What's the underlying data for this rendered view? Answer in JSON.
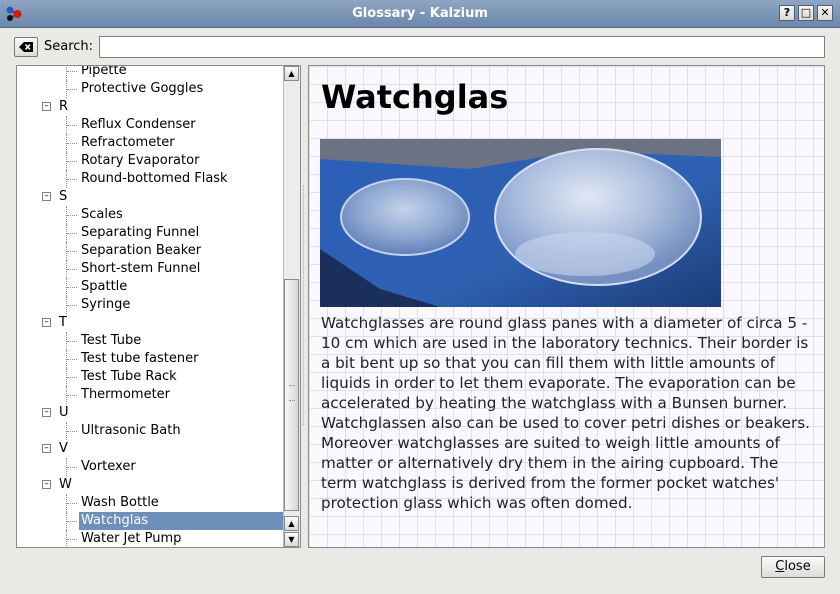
{
  "window": {
    "title": "Glossary - Kalzium"
  },
  "titlebar_buttons": {
    "help": "?",
    "maximize": "□",
    "close": "✕"
  },
  "search": {
    "label": "Search:",
    "value": "",
    "placeholder": ""
  },
  "tree": {
    "rows": [
      {
        "type": "item",
        "label": "Pipette"
      },
      {
        "type": "item",
        "label": "Protective Goggles"
      },
      {
        "type": "group",
        "label": "R"
      },
      {
        "type": "item",
        "label": "Reflux Condenser"
      },
      {
        "type": "item",
        "label": "Refractometer"
      },
      {
        "type": "item",
        "label": "Rotary Evaporator"
      },
      {
        "type": "item",
        "label": "Round-bottomed Flask"
      },
      {
        "type": "group",
        "label": "S"
      },
      {
        "type": "item",
        "label": "Scales"
      },
      {
        "type": "item",
        "label": "Separating Funnel"
      },
      {
        "type": "item",
        "label": "Separation Beaker"
      },
      {
        "type": "item",
        "label": "Short-stem Funnel"
      },
      {
        "type": "item",
        "label": "Spattle"
      },
      {
        "type": "item",
        "label": "Syringe"
      },
      {
        "type": "group",
        "label": "T"
      },
      {
        "type": "item",
        "label": "Test Tube"
      },
      {
        "type": "item",
        "label": "Test tube fastener"
      },
      {
        "type": "item",
        "label": "Test Tube Rack"
      },
      {
        "type": "item",
        "label": "Thermometer"
      },
      {
        "type": "group",
        "label": "U"
      },
      {
        "type": "item",
        "label": "Ultrasonic Bath"
      },
      {
        "type": "group",
        "label": "V"
      },
      {
        "type": "item",
        "label": "Vortexer"
      },
      {
        "type": "group",
        "label": "W"
      },
      {
        "type": "item",
        "label": "Wash Bottle"
      },
      {
        "type": "item",
        "label": "Watchglas",
        "selected": true
      },
      {
        "type": "item",
        "label": "Water Jet Pump"
      }
    ],
    "scroll_position": 0.9
  },
  "article": {
    "title": "Watchglas",
    "description": "Watchglasses are round glass panes with a diameter of circa 5 - 10 cm which are used in the laboratory technics. Their border is a bit bent up so that you can fill them with little amounts of liquids in order to let them evaporate. The evaporation can be accelerated by heating the watchglass with a Bunsen burner. Watchglassen also can be used to cover petri dishes or beakers. Moreover watchglasses are suited to weigh little amounts of matter or alternatively dry them in the airing cupboard. The term watchglass is derived from the former pocket watches' protection glass which was often domed."
  },
  "buttons": {
    "close_prefix": "",
    "close_mnemonic": "C",
    "close_rest": "lose"
  },
  "colors": {
    "selection": "#6d8fba",
    "titlebar": "#7b93b3",
    "photo_background": "#2f5fb0"
  }
}
